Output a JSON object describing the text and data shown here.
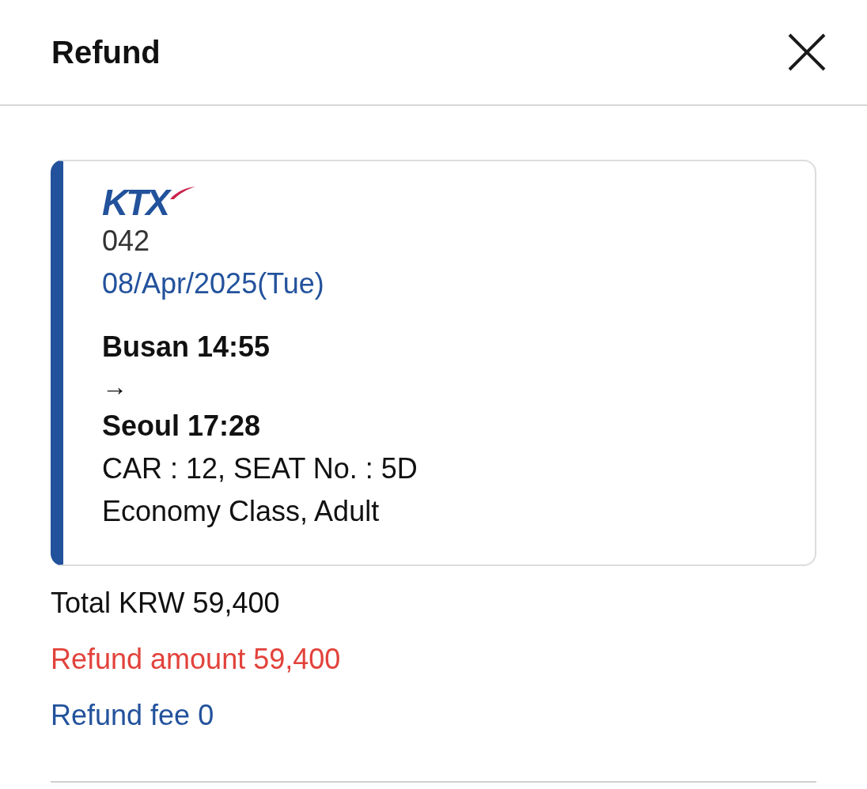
{
  "header": {
    "title": "Refund"
  },
  "ticket": {
    "logo": "KTX",
    "train_number": "042",
    "date": "08/Apr/2025(Tue)",
    "departure": "Busan 14:55",
    "arrow": "→",
    "arrival": "Seoul 17:28",
    "seat": "CAR : 12, SEAT No. : 5D",
    "fare_class": "Economy Class, Adult"
  },
  "summary": [
    {
      "kind": "total",
      "text": "Total KRW 59,400"
    },
    {
      "kind": "refund_amount",
      "text": "Refund amount 59,400"
    },
    {
      "kind": "refund_fee",
      "text": "Refund fee 0"
    }
  ]
}
